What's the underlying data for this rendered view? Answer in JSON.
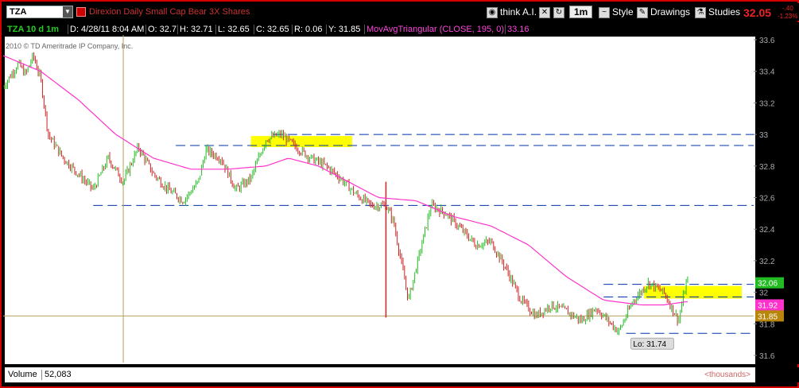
{
  "toolbar": {
    "symbol": "TZA",
    "description": "Direxion Daily Small Cap Bear 3X Shares",
    "think_ai": "think A.I.",
    "timeframe": "1m",
    "style": "Style",
    "drawings": "Drawings",
    "studies": "Studies",
    "last_price": "32.05",
    "change_abs": "-.40",
    "change_pct": "-1.23%"
  },
  "header": {
    "chart_id": "TZA 10 d 1m",
    "date": "D: 4/28/11 8:04 AM",
    "open": "O: 32.7",
    "high": "H: 32.71",
    "low": "L: 32.65",
    "close": "C: 32.65",
    "range": "R: 0.06",
    "y": "Y: 31.85",
    "study": "MovAvgTriangular (CLOSE, 195, 0)",
    "study_value": "33.16"
  },
  "copyright": "2010 © TD Ameritrade IP Company, Inc.",
  "volume": {
    "label": "Volume",
    "value": "52,083",
    "units": "<thousands>"
  },
  "colors": {
    "up": "#22bb22",
    "down": "#cc2222",
    "ma": "#ff33cc",
    "dash": "#0033aa",
    "highlight": "#ffff00",
    "cursor": "#b8a060"
  },
  "chart_data": {
    "type": "candlestick",
    "ylim": [
      31.52,
      33.65
    ],
    "yticks": [
      "33.6",
      "33.4",
      "33.2",
      "33",
      "32.8",
      "32.6",
      "32.4",
      "32.2",
      "32",
      "31.8",
      "31.6"
    ],
    "price_path": [
      [
        0,
        33.3
      ],
      [
        2,
        33.45
      ],
      [
        3,
        33.38
      ],
      [
        4,
        33.5
      ],
      [
        5,
        33.35
      ],
      [
        6,
        33.0
      ],
      [
        8,
        32.85
      ],
      [
        10,
        32.75
      ],
      [
        12,
        32.65
      ],
      [
        14,
        32.85
      ],
      [
        16,
        32.7
      ],
      [
        18,
        32.92
      ],
      [
        20,
        32.75
      ],
      [
        22,
        32.65
      ],
      [
        24,
        32.58
      ],
      [
        26,
        32.7
      ],
      [
        27,
        32.9
      ],
      [
        29,
        32.85
      ],
      [
        31,
        32.65
      ],
      [
        33,
        32.72
      ],
      [
        35,
        32.97
      ],
      [
        37,
        33.0
      ],
      [
        39,
        32.92
      ],
      [
        41,
        32.85
      ],
      [
        43,
        32.8
      ],
      [
        45,
        32.72
      ],
      [
        47,
        32.62
      ],
      [
        49,
        32.55
      ],
      [
        51,
        32.55
      ],
      [
        52,
        32.45
      ],
      [
        54,
        31.95
      ],
      [
        55,
        32.15
      ],
      [
        57,
        32.55
      ],
      [
        59,
        32.5
      ],
      [
        61,
        32.4
      ],
      [
        63,
        32.3
      ],
      [
        65,
        32.32
      ],
      [
        67,
        32.15
      ],
      [
        69,
        31.95
      ],
      [
        71,
        31.85
      ],
      [
        73,
        31.92
      ],
      [
        75,
        31.88
      ],
      [
        77,
        31.82
      ],
      [
        79,
        31.9
      ],
      [
        81,
        31.8
      ],
      [
        82,
        31.75
      ],
      [
        84,
        31.95
      ],
      [
        86,
        32.06
      ],
      [
        88,
        32.0
      ],
      [
        90,
        31.82
      ],
      [
        91,
        32.06
      ]
    ],
    "ma_path": [
      [
        0,
        33.5
      ],
      [
        5,
        33.4
      ],
      [
        10,
        33.22
      ],
      [
        15,
        33.0
      ],
      [
        20,
        32.85
      ],
      [
        25,
        32.78
      ],
      [
        30,
        32.78
      ],
      [
        35,
        32.8
      ],
      [
        38,
        32.85
      ],
      [
        42,
        32.8
      ],
      [
        46,
        32.7
      ],
      [
        50,
        32.6
      ],
      [
        55,
        32.58
      ],
      [
        60,
        32.48
      ],
      [
        65,
        32.42
      ],
      [
        70,
        32.3
      ],
      [
        75,
        32.1
      ],
      [
        80,
        31.95
      ],
      [
        85,
        31.92
      ],
      [
        88,
        31.92
      ],
      [
        91,
        31.94
      ]
    ],
    "spike": {
      "x": 51,
      "high": 32.7,
      "low": 31.84
    },
    "dashed_levels": [
      {
        "y": 33.0,
        "x0": 36,
        "x1": 100
      },
      {
        "y": 32.93,
        "x0": 23,
        "x1": 100
      },
      {
        "y": 32.55,
        "x0": 12,
        "x1": 100
      },
      {
        "y": 32.05,
        "x0": 80,
        "x1": 100
      },
      {
        "y": 31.97,
        "x0": 80,
        "x1": 100
      },
      {
        "y": 31.74,
        "x0": 83,
        "x1": 100
      }
    ],
    "highlights": [
      {
        "x0": 33,
        "x1": 46.5,
        "y0": 32.92,
        "y1": 32.99
      },
      {
        "x0": 85.4,
        "x1": 98.4,
        "y0": 31.96,
        "y1": 32.04
      }
    ],
    "cursor": {
      "x": 16,
      "y": 31.85
    },
    "labels": [
      {
        "text": "32.06",
        "y": 32.06,
        "color": "#22bb22",
        "fg": "#fff"
      },
      {
        "text": "31.92",
        "y": 31.92,
        "color": "#ff33cc",
        "fg": "#fff"
      },
      {
        "text": "31.85",
        "y": 31.85,
        "color": "#b8860b",
        "fg": "#fff"
      }
    ],
    "low_label": {
      "text": "Lo: 31.74",
      "x": 86.8,
      "y": 31.74
    }
  }
}
